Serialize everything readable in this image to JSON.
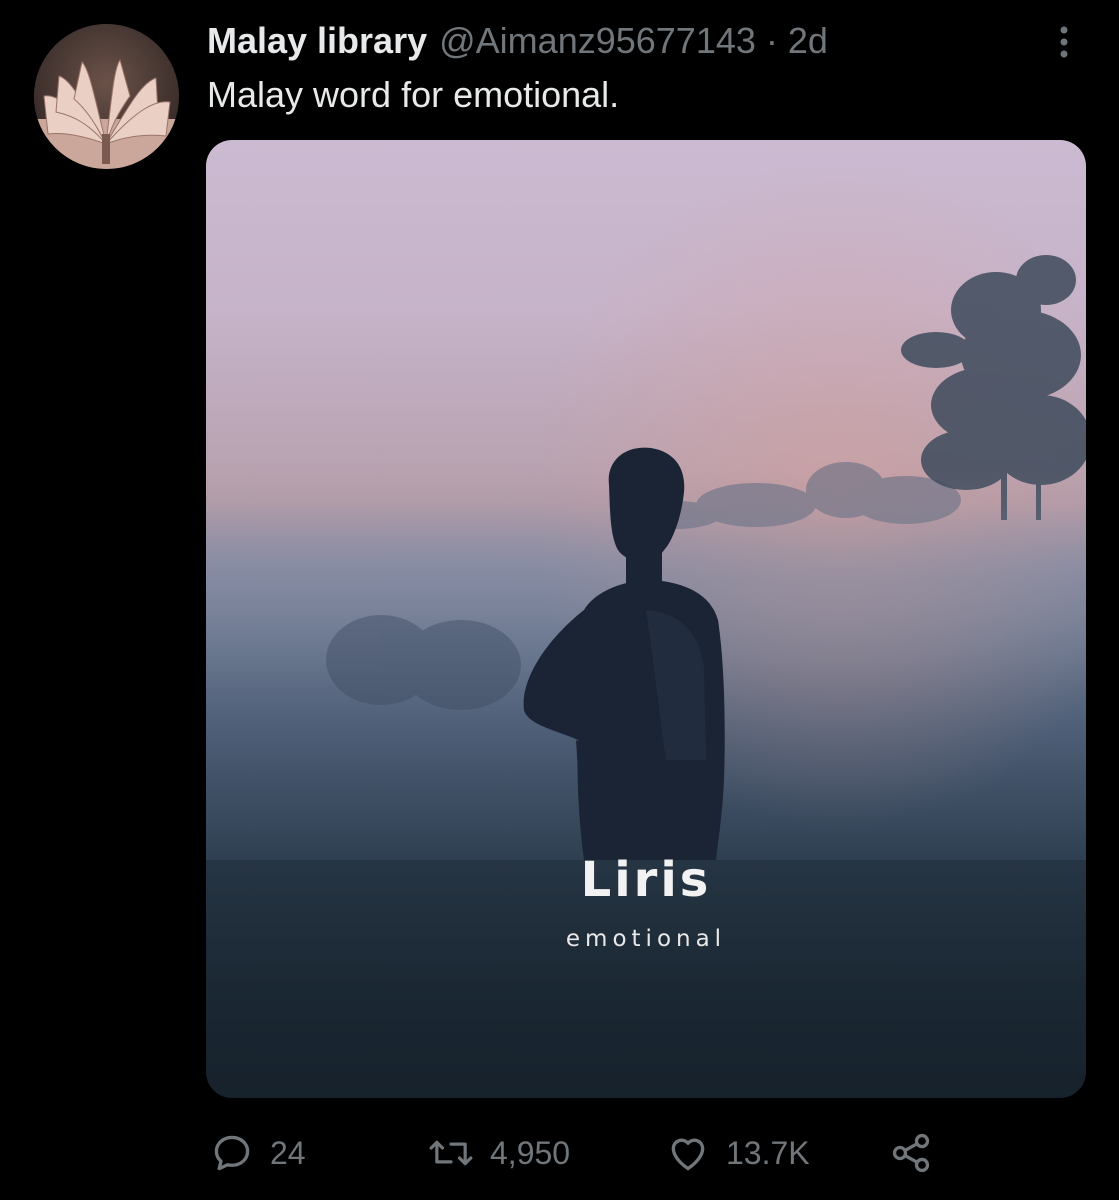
{
  "tweet": {
    "display_name": "Malay library",
    "handle": "@Aimanz95677143",
    "separator": "·",
    "timestamp": "2d",
    "text": "Malay word for emotional.",
    "avatar_icon": "book-pages-avatar"
  },
  "media": {
    "word": "Liris",
    "meaning": "emotional"
  },
  "actions": {
    "reply": {
      "icon": "reply-icon",
      "count": "24"
    },
    "retweet": {
      "icon": "retweet-icon",
      "count": "4,950"
    },
    "like": {
      "icon": "heart-icon",
      "count": "13.7K"
    },
    "share": {
      "icon": "share-icon"
    },
    "more": {
      "icon": "more-vertical-icon"
    }
  },
  "colors": {
    "background": "#000000",
    "primary_text": "#e7e9ea",
    "secondary_text": "#71767b"
  }
}
